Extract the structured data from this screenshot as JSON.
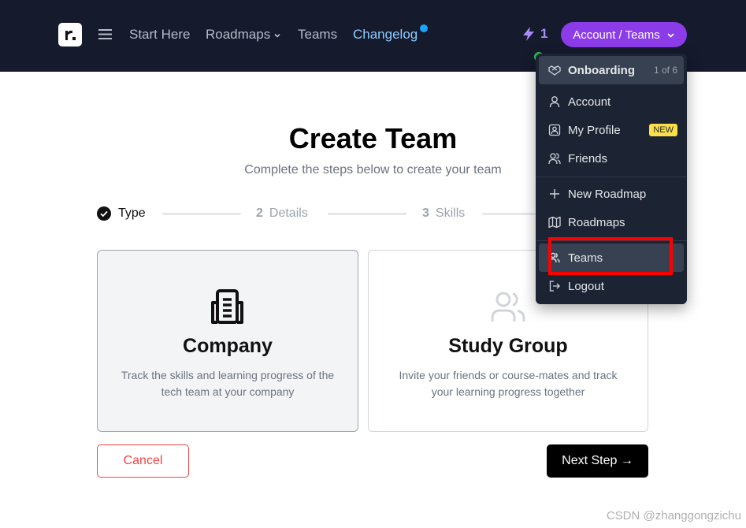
{
  "nav": {
    "links": [
      "Start Here",
      "Roadmaps",
      "Teams",
      "Changelog"
    ],
    "streak_count": "1",
    "account_label": "Account / Teams"
  },
  "dropdown": {
    "onboarding_label": "Onboarding",
    "onboarding_progress": "1 of 6",
    "account": "Account",
    "my_profile": "My Profile",
    "new_badge": "NEW",
    "friends": "Friends",
    "new_roadmap": "New Roadmap",
    "roadmaps": "Roadmaps",
    "teams": "Teams",
    "logout": "Logout"
  },
  "page": {
    "title": "Create Team",
    "subtitle": "Complete the steps below to create your team"
  },
  "steps": [
    {
      "num": "",
      "label": "Type",
      "state": "done"
    },
    {
      "num": "2",
      "label": "Details",
      "state": "pending"
    },
    {
      "num": "3",
      "label": "Skills",
      "state": "pending"
    }
  ],
  "cards": [
    {
      "title": "Company",
      "description": "Track the skills and learning progress of the tech team at your company",
      "icon": "building-icon",
      "selected": true
    },
    {
      "title": "Study Group",
      "description": "Invite your friends or course-mates and track your learning progress together",
      "icon": "users-icon",
      "selected": false
    }
  ],
  "actions": {
    "cancel": "Cancel",
    "next": "Next Step →"
  },
  "watermark": "CSDN @zhanggongzichu",
  "colors": {
    "nav_bg": "#151a2d",
    "accent_purple": "#8b3be8",
    "changelog_blue": "#8ecbff",
    "cancel_red": "#ef4444",
    "new_badge_yellow": "#fde047",
    "highlight_red": "#ff0000"
  }
}
